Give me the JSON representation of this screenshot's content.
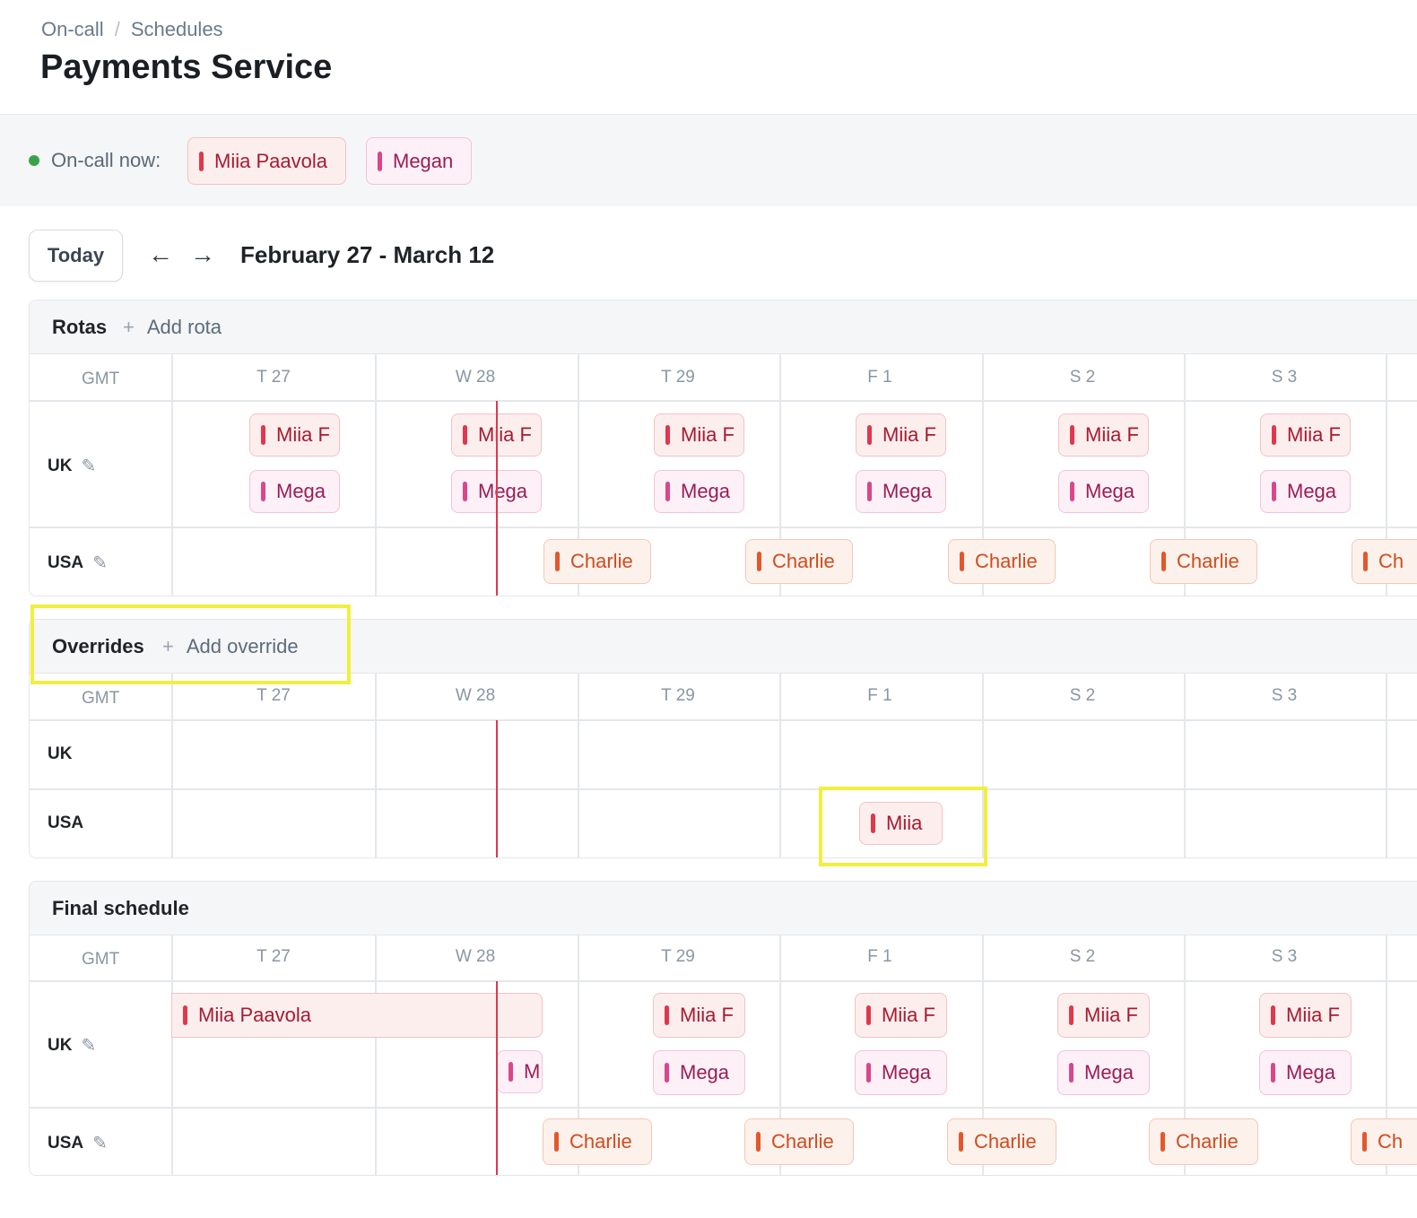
{
  "breadcrumb": {
    "parent": "On-call",
    "separator": "/",
    "current": "Schedules"
  },
  "page_title": "Payments Service",
  "oncall_now": {
    "label": "On-call now:",
    "people": [
      {
        "name": "Miia Paavola",
        "color": "#e0374c"
      },
      {
        "name": "Megan",
        "color": "#d9468b"
      }
    ]
  },
  "toolbar": {
    "today_label": "Today",
    "prev_icon": "←",
    "next_icon": "→",
    "date_range": "February 27 - March 12"
  },
  "timezone": "GMT",
  "days": [
    "T 27",
    "W 28",
    "T 29",
    "F 1",
    "S 2",
    "S 3"
  ],
  "rotas": {
    "title": "Rotas",
    "add_label": "Add rota",
    "rows": [
      {
        "label": "UK",
        "shifts": [
          "Miia F",
          "Miia F",
          "Miia F",
          "Miia F",
          "Miia F",
          "Miia F"
        ],
        "shifts2": [
          "Mega",
          "Mega",
          "Mega",
          "Mega",
          "Mega",
          "Mega"
        ]
      },
      {
        "label": "USA",
        "shifts": [
          "Charlie",
          "Charlie",
          "Charlie",
          "Charlie",
          "Ch"
        ]
      }
    ]
  },
  "overrides": {
    "title": "Overrides",
    "add_label": "Add override",
    "rows": [
      {
        "label": "UK"
      },
      {
        "label": "USA",
        "shift": "Miia"
      }
    ]
  },
  "final_schedule": {
    "title": "Final schedule",
    "rows": [
      {
        "label": "UK",
        "long_shift": "Miia Paavola",
        "short_shift": "M",
        "shifts": [
          "Miia F",
          "Miia F",
          "Miia F",
          "Miia F"
        ],
        "shifts2": [
          "Mega",
          "Mega",
          "Mega",
          "Mega"
        ]
      },
      {
        "label": "USA",
        "shifts": [
          "Charlie",
          "Charlie",
          "Charlie",
          "Charlie",
          "Ch"
        ]
      }
    ]
  },
  "colors": {
    "accent_red": "#e0374c",
    "accent_pink": "#d9468b",
    "accent_orange": "#e2582b",
    "highlight": "#f2ef3c",
    "status_green": "#3aa34a"
  }
}
